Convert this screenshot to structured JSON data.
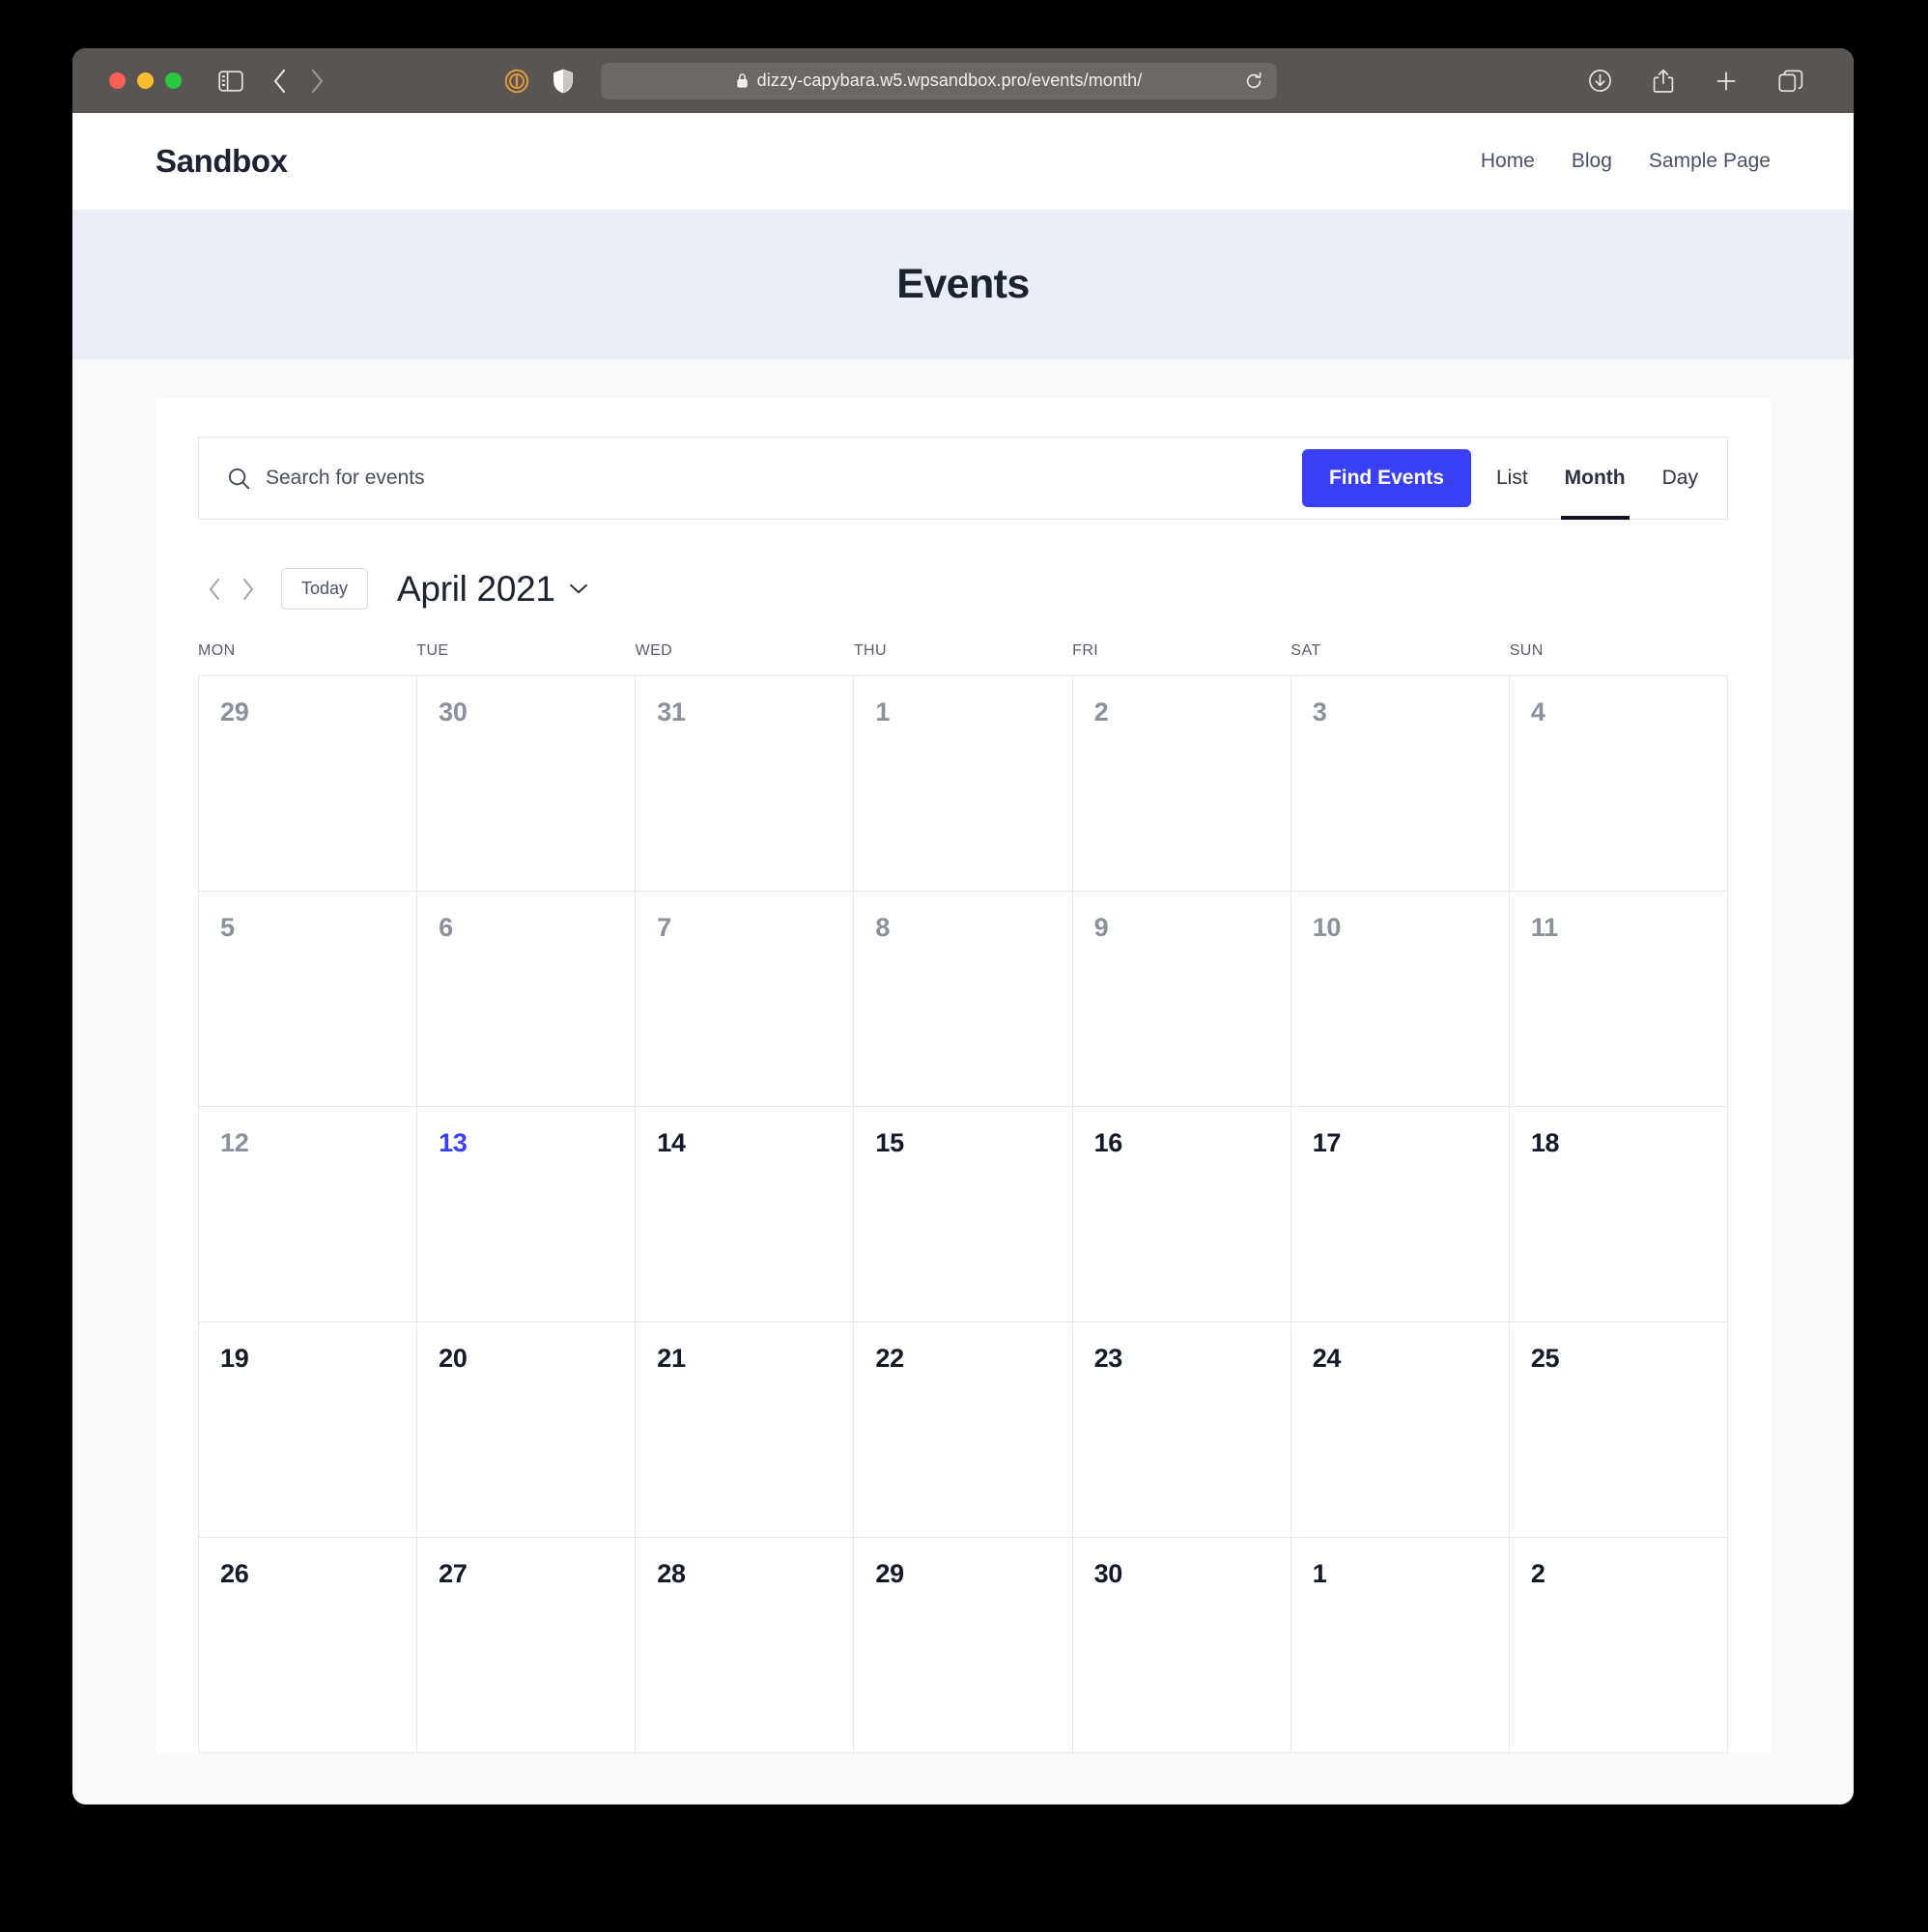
{
  "browser": {
    "url": "dizzy-capybara.w5.wpsandbox.pro/events/month/",
    "lock_icon": "lock-icon",
    "reload_icon": "reload-icon",
    "sidebar_icon": "sidebar-toggle-icon",
    "back_icon": "back-chevron-icon",
    "forward_icon": "forward-chevron-icon",
    "extension_icon": "extension-icon",
    "shield_icon": "privacy-shield-icon",
    "downloads_icon": "downloads-icon",
    "share_icon": "share-icon",
    "new_tab_icon": "new-tab-icon",
    "tab_overview_icon": "tab-overview-icon"
  },
  "site": {
    "title": "Sandbox",
    "nav": [
      {
        "label": "Home"
      },
      {
        "label": "Blog"
      },
      {
        "label": "Sample Page"
      }
    ]
  },
  "hero": {
    "title": "Events"
  },
  "search": {
    "placeholder": "Search for events",
    "value": "",
    "icon": "search-icon",
    "find_events_label": "Find Events"
  },
  "view_tabs": [
    {
      "label": "List",
      "active": false
    },
    {
      "label": "Month",
      "active": true
    },
    {
      "label": "Day",
      "active": false
    }
  ],
  "date_nav": {
    "prev_icon": "chevron-left-icon",
    "next_icon": "chevron-right-icon",
    "today_label": "Today",
    "month_label": "April 2021",
    "dropdown_icon": "chevron-down-icon"
  },
  "calendar": {
    "weekdays": [
      "MON",
      "TUE",
      "WED",
      "THU",
      "FRI",
      "SAT",
      "SUN"
    ],
    "accent_color": "#3a40f5",
    "past_color": "#8b909d",
    "future_color": "#151a28",
    "weeks": [
      [
        {
          "day": "29",
          "state": "past"
        },
        {
          "day": "30",
          "state": "past"
        },
        {
          "day": "31",
          "state": "past"
        },
        {
          "day": "1",
          "state": "past"
        },
        {
          "day": "2",
          "state": "past"
        },
        {
          "day": "3",
          "state": "past"
        },
        {
          "day": "4",
          "state": "past"
        }
      ],
      [
        {
          "day": "5",
          "state": "past"
        },
        {
          "day": "6",
          "state": "past"
        },
        {
          "day": "7",
          "state": "past"
        },
        {
          "day": "8",
          "state": "past"
        },
        {
          "day": "9",
          "state": "past"
        },
        {
          "day": "10",
          "state": "past"
        },
        {
          "day": "11",
          "state": "past"
        }
      ],
      [
        {
          "day": "12",
          "state": "past"
        },
        {
          "day": "13",
          "state": "current"
        },
        {
          "day": "14",
          "state": "future"
        },
        {
          "day": "15",
          "state": "future"
        },
        {
          "day": "16",
          "state": "future"
        },
        {
          "day": "17",
          "state": "future"
        },
        {
          "day": "18",
          "state": "future"
        }
      ],
      [
        {
          "day": "19",
          "state": "future"
        },
        {
          "day": "20",
          "state": "future"
        },
        {
          "day": "21",
          "state": "future"
        },
        {
          "day": "22",
          "state": "future"
        },
        {
          "day": "23",
          "state": "future"
        },
        {
          "day": "24",
          "state": "future"
        },
        {
          "day": "25",
          "state": "future"
        }
      ],
      [
        {
          "day": "26",
          "state": "future"
        },
        {
          "day": "27",
          "state": "future"
        },
        {
          "day": "28",
          "state": "future"
        },
        {
          "day": "29",
          "state": "future"
        },
        {
          "day": "30",
          "state": "future"
        },
        {
          "day": "1",
          "state": "future"
        },
        {
          "day": "2",
          "state": "future"
        }
      ]
    ]
  }
}
